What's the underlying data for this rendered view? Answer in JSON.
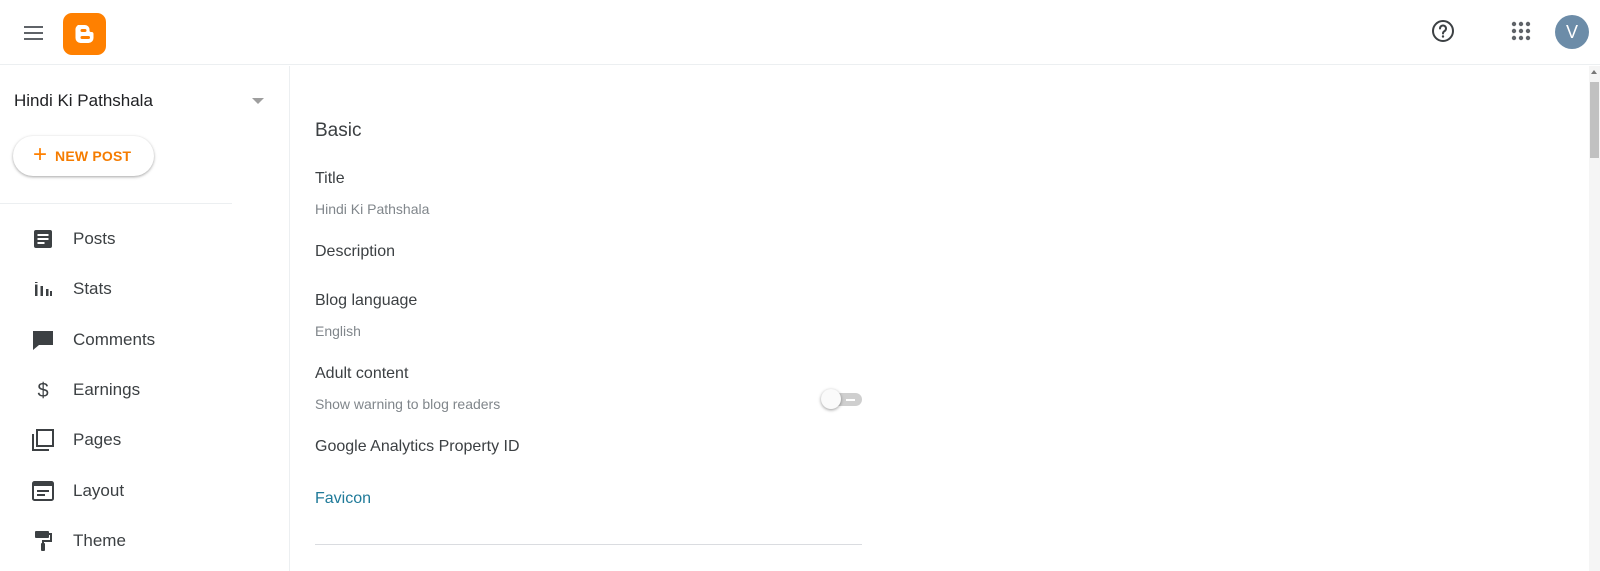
{
  "header": {
    "menu_icon": "hamburger-menu-icon",
    "logo_icon": "blogger-logo-icon",
    "help_icon": "help-circle-icon",
    "apps_icon": "apps-grid-icon",
    "avatar_letter": "V",
    "brand_color": "#ff8000",
    "avatar_color": "#6c8ca8"
  },
  "sidebar": {
    "blog_name": "Hindi Ki Pathshala",
    "new_post": {
      "plus": "+",
      "label": "NEW POST"
    },
    "items": [
      {
        "label": "Posts",
        "icon": "posts-icon"
      },
      {
        "label": "Stats",
        "icon": "stats-icon"
      },
      {
        "label": "Comments",
        "icon": "comments-icon"
      },
      {
        "label": "Earnings",
        "icon": "dollar-icon"
      },
      {
        "label": "Pages",
        "icon": "pages-icon"
      },
      {
        "label": "Layout",
        "icon": "layout-icon"
      },
      {
        "label": "Theme",
        "icon": "paint-roller-icon"
      }
    ]
  },
  "main": {
    "section_title": "Basic",
    "settings": {
      "title": {
        "label": "Title",
        "value": "Hindi Ki Pathshala"
      },
      "description": {
        "label": "Description"
      },
      "blog_language": {
        "label": "Blog language",
        "value": "English"
      },
      "adult_content": {
        "label": "Adult content",
        "value": "Show warning to blog readers",
        "enabled": false
      },
      "analytics": {
        "label": "Google Analytics Property ID"
      }
    },
    "favicon_link": "Favicon",
    "link_color": "#1f7a99"
  }
}
